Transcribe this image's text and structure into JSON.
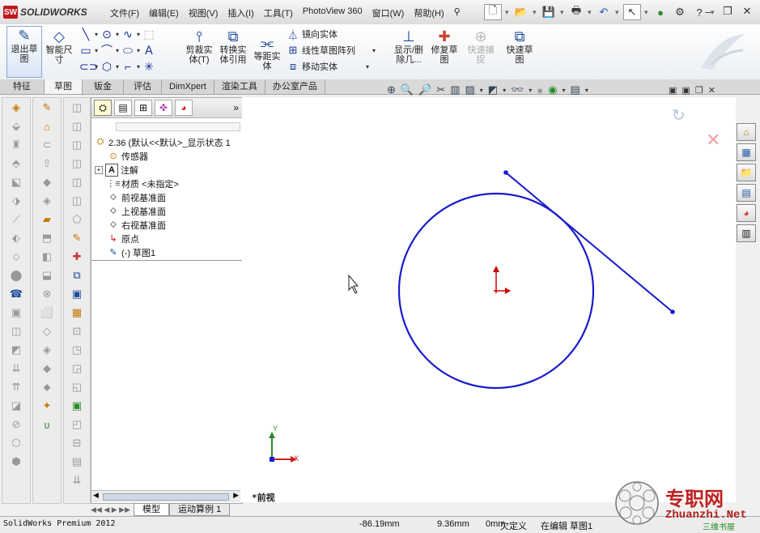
{
  "app": {
    "logo_text": "SOLIDWORKS",
    "logo_mark": "SW",
    "status_product": "SolidWorks Premium 2012"
  },
  "menu": [
    "文件(F)",
    "编辑(E)",
    "视图(V)",
    "插入(I)",
    "工具(T)",
    "PhotoView 360",
    "窗口(W)",
    "帮助(H)"
  ],
  "ribbon": {
    "exit_sketch": "退出草图",
    "smart_dimension": "智能尺寸",
    "trim": "剪裁实体(T)",
    "convert": "转换实体引用",
    "offset": "等距实体",
    "mirror": "镜向实体",
    "linear_pattern": "线性草图阵列",
    "move": "移动实体",
    "show_delete": "显示/删除几...",
    "repair": "修复草图",
    "quick_snap": "快速捕捉",
    "rapid_sketch": "快速草图"
  },
  "tabs": [
    "特征",
    "草图",
    "钣金",
    "评估",
    "DimXpert",
    "渲染工具",
    "办公室产品"
  ],
  "tree": {
    "root": "2.36 (默认<<默认>_显示状态 1",
    "items": [
      "传感器",
      "注解",
      "材质 <未指定>",
      "前视基准面",
      "上视基准面",
      "右视基准面",
      "原点",
      "(-) 草图1"
    ]
  },
  "bottom_tabs": [
    "模型",
    "运动算例 1"
  ],
  "viewport": {
    "view_label": "*前视",
    "axis_x": "X",
    "axis_y": "Y"
  },
  "status": {
    "x": "-86.19mm",
    "y": "9.36mm",
    "z": "0mm",
    "state": "欠定义",
    "editing": "在编辑 草图1"
  },
  "watermark": {
    "text": "专职网",
    "url": "Zhuanzhi.Net",
    "sub": "三维书屋"
  },
  "colors": {
    "sketch": "#1a1acc",
    "origin": "#cc0000",
    "accent": "#c0161a"
  }
}
